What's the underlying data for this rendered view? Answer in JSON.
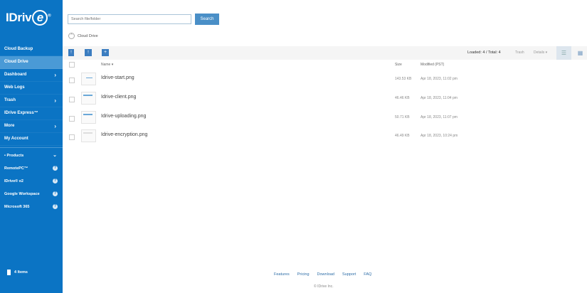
{
  "app": {
    "logo_text": "IDriv",
    "logo_e": "e",
    "logo_mark": "®"
  },
  "search": {
    "placeholder": "Search file/folder",
    "button_label": "Search"
  },
  "breadcrumb": {
    "label": "Cloud Drive"
  },
  "sidebar": {
    "items": [
      {
        "label": "Cloud Backup",
        "chevron": ""
      },
      {
        "label": "Cloud Drive",
        "chevron": "",
        "active": true
      },
      {
        "label": "Dashboard",
        "chevron": "›"
      },
      {
        "label": "Web Logs",
        "chevron": ""
      },
      {
        "label": "Trash",
        "chevron": "›"
      },
      {
        "label": "IDrive Express™",
        "chevron": ""
      },
      {
        "label": "More",
        "chevron": "›"
      },
      {
        "label": "My Account",
        "chevron": ""
      }
    ],
    "products_label": "Products",
    "products": [
      {
        "label": "RemotePC™"
      },
      {
        "label": "IDrive® e2"
      },
      {
        "label": "Google Workspace"
      },
      {
        "label": "Microsoft 365"
      }
    ],
    "items_count": "4 Items"
  },
  "toolbar": {
    "loaded": "Loaded: 4 / Total: 4",
    "trash": "Trash",
    "details": "Details ▾"
  },
  "table": {
    "columns": {
      "name": "Name ▾",
      "size": "Size",
      "modified": "Modified (PST)"
    },
    "rows": [
      {
        "name": "Idrive-start.png",
        "size": "143.53 KB",
        "modified": "Apr 18, 2023, 11:02 pm"
      },
      {
        "name": "Idrive-client.png",
        "size": "46.46 KB",
        "modified": "Apr 18, 2023, 11:04 pm"
      },
      {
        "name": "Idrive-uploading.png",
        "size": "50.71 KB",
        "modified": "Apr 18, 2023, 11:07 pm"
      },
      {
        "name": "Idrive-encryption.png",
        "size": "46.49 KB",
        "modified": "Apr 18, 2023, 10:24 pm"
      }
    ]
  },
  "footer": {
    "links": [
      "Features",
      "Pricing",
      "Download",
      "Support",
      "FAQ"
    ],
    "copyright": "© IDrive Inc."
  },
  "colors": {
    "sidebar": "#0b74c4",
    "active": "#4a9ad6",
    "button": "#4a8fc7"
  }
}
